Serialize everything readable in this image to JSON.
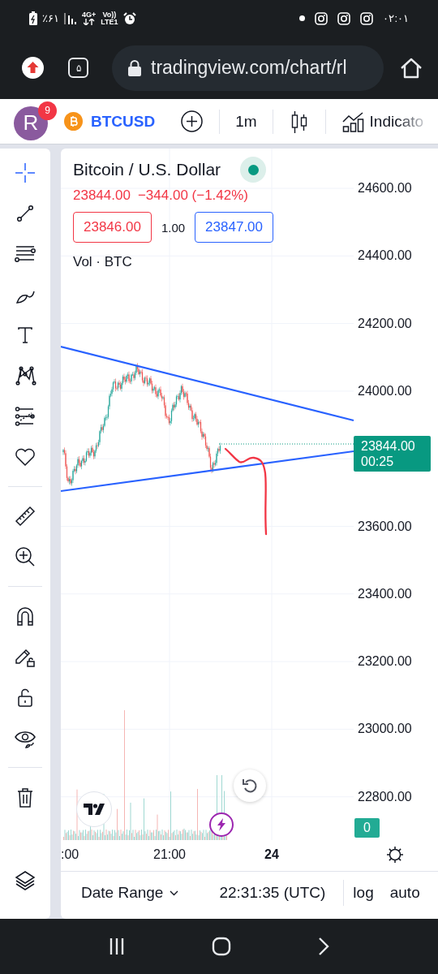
{
  "status_bar": {
    "battery": "٪۶۱",
    "network": "4G+",
    "volte": "Vo))",
    "lte": "LTE1",
    "time": "۰۲:۰۱"
  },
  "browser": {
    "tab_count": "۵",
    "url": "tradingview.com/chart/rl"
  },
  "toolbar": {
    "avatar": "R",
    "notifications": "9",
    "symbol": "BTCUSD",
    "interval": "1m",
    "indicators": "Indicato"
  },
  "tool_groups": [
    [
      {
        "kind": "crosshair",
        "selected": true
      },
      {
        "kind": "trend-line",
        "selected": false
      },
      {
        "kind": "fib",
        "selected": false
      },
      {
        "kind": "brush",
        "selected": false
      },
      {
        "kind": "text",
        "selected": false
      },
      {
        "kind": "pattern",
        "selected": false
      },
      {
        "kind": "prediction",
        "selected": false
      },
      {
        "kind": "heart",
        "selected": false
      }
    ],
    [
      {
        "kind": "ruler",
        "selected": false
      },
      {
        "kind": "zoom",
        "selected": false
      }
    ],
    [
      {
        "kind": "magnet",
        "selected": false
      },
      {
        "kind": "pencil-lock",
        "selected": false
      },
      {
        "kind": "lock",
        "selected": false
      },
      {
        "kind": "eye",
        "selected": false
      }
    ],
    [
      {
        "kind": "trash",
        "selected": false
      }
    ]
  ],
  "legend": {
    "title": "Bitcoin / U.S. Dollar",
    "market_open": true,
    "price": "23844.00",
    "change": "−344.00 (−1.42%)",
    "sell": "23846.00",
    "spread": "1.00",
    "buy": "23847.00",
    "volume": "Vol · BTC"
  },
  "price_scale": [
    "24600.00",
    "24400.00",
    "24200.00",
    "24000.00",
    "23600.00",
    "23400.00",
    "23200.00",
    "23000.00",
    "22800.00"
  ],
  "last_price": {
    "price": "23844.00",
    "countdown": "00:25"
  },
  "volume_price": "0",
  "time_scale": [
    {
      "label": ":00",
      "kind": "time"
    },
    {
      "label": "21:00",
      "kind": "time"
    },
    {
      "label": "24",
      "kind": "day"
    }
  ],
  "bottom_bar": {
    "date_range": "Date Range",
    "clock": "22:31:35 (UTC)",
    "log": "log",
    "auto": "auto"
  }
}
